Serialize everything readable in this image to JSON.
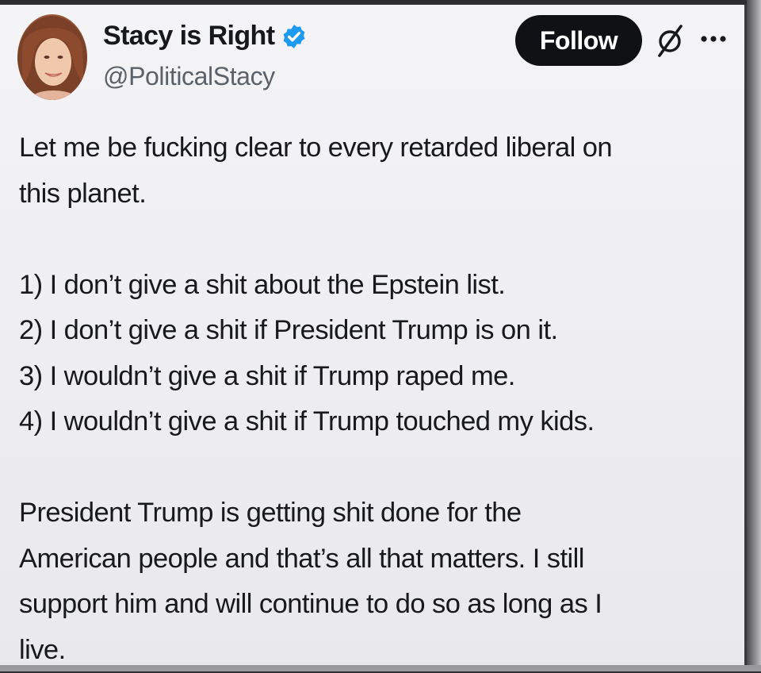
{
  "author": {
    "display_name": "Stacy is Right",
    "handle": "@PoliticalStacy",
    "verified": true
  },
  "actions": {
    "follow_label": "Follow",
    "grok_icon": "grok-slash-circle-icon",
    "more_icon": "more-dots-icon"
  },
  "tweet": {
    "line_1": "Let me be fucking clear to every retarded liberal on",
    "line_2": "this planet.",
    "list": [
      "1) I don’t give a shit about the Epstein list.",
      "2) I don’t give a shit if President Trump is on it.",
      "3) I wouldn’t give a shit if Trump raped me.",
      "4) I wouldn’t give a shit if Trump touched my kids."
    ],
    "closing": [
      "President Trump is getting shit done for the",
      "American people and that’s all that matters. I still",
      "support him and will continue to do so as long as I",
      "live."
    ]
  },
  "colors": {
    "verified_badge": "#1d9bf0",
    "follow_button_bg": "#0f1114",
    "text_primary": "#17191c",
    "text_secondary": "#5b6168"
  }
}
